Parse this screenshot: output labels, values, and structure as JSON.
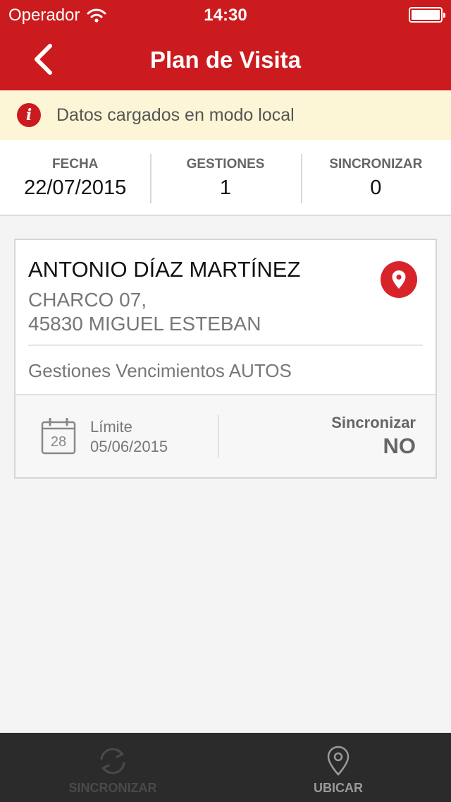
{
  "status_bar": {
    "carrier": "Operador",
    "time": "14:30"
  },
  "nav": {
    "title": "Plan de Visita"
  },
  "alert": {
    "icon": "info-icon",
    "message": "Datos cargados en modo local"
  },
  "summary": {
    "fecha_label": "FECHA",
    "fecha_value": "22/07/2015",
    "gestiones_label": "GESTIONES",
    "gestiones_value": "1",
    "sincronizar_label": "SINCRONIZAR",
    "sincronizar_value": "0"
  },
  "visit": {
    "client_name": "ANTONIO DÍAZ MARTÍNEZ",
    "address_line1": "CHARCO 07,",
    "address_line2": "45830 MIGUEL ESTEBAN",
    "description": "Gestiones Vencimientos AUTOS",
    "calendar_day": "28",
    "limit_label": "Límite",
    "limit_date": "05/06/2015",
    "sync_label": "Sincronizar",
    "sync_value": "NO"
  },
  "tabbar": {
    "sync_label": "SINCRONIZAR",
    "locate_label": "UBICAR"
  },
  "colors": {
    "brand_red": "#cc1b1e",
    "alert_bg": "#fcf5d6",
    "tabbar_bg": "#2b2b2b"
  }
}
